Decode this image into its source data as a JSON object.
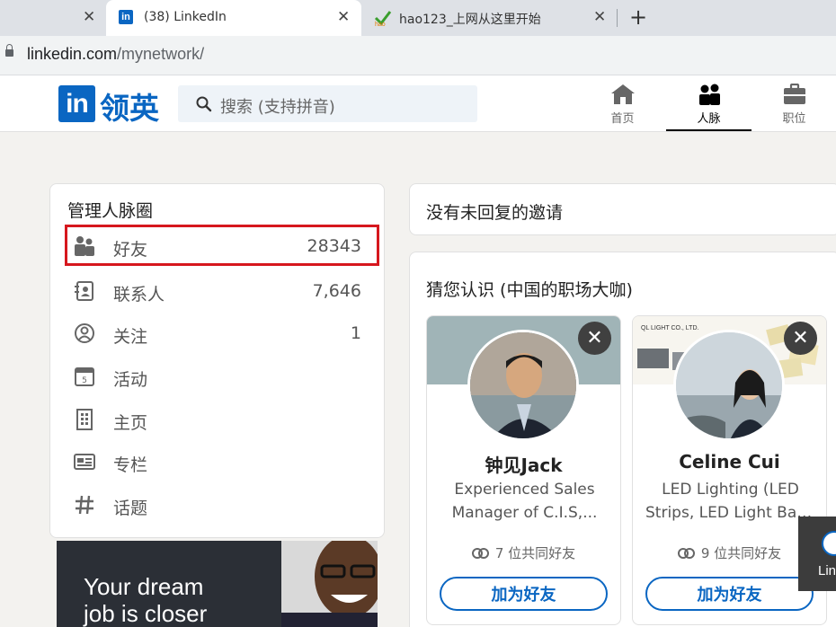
{
  "browser": {
    "tabs": [
      {
        "title": "",
        "close": "✕"
      },
      {
        "title": "(38) LinkedIn",
        "close": "✕"
      },
      {
        "title": "hao123_上网从这里开始",
        "close": "✕"
      }
    ],
    "new_tab": "+",
    "url_host": "linkedin.com",
    "url_path": "/mynetwork/"
  },
  "header": {
    "logo_mark": "in",
    "logo_text": "领英",
    "search_placeholder": "搜索 (支持拼音)",
    "nav": [
      {
        "label": "首页",
        "icon": "home-icon"
      },
      {
        "label": "人脉",
        "icon": "people-icon",
        "active": true
      },
      {
        "label": "职位",
        "icon": "briefcase-icon"
      }
    ]
  },
  "manage": {
    "title": "管理人脉圈",
    "items": [
      {
        "label": "好友",
        "count": "28343",
        "icon": "connections-icon",
        "highlighted": true
      },
      {
        "label": "联系人",
        "count": "7,646",
        "icon": "contacts-icon"
      },
      {
        "label": "关注",
        "count": "1",
        "icon": "following-icon"
      },
      {
        "label": "活动",
        "count": "",
        "icon": "calendar-icon"
      },
      {
        "label": "主页",
        "count": "",
        "icon": "building-icon"
      },
      {
        "label": "专栏",
        "count": "",
        "icon": "newspaper-icon"
      },
      {
        "label": "话题",
        "count": "",
        "icon": "hashtag-icon"
      }
    ],
    "ad_text_line1": "Your dream",
    "ad_text_line2": "job is closer"
  },
  "invitations": {
    "text": "没有未回复的邀请"
  },
  "pymk": {
    "title": "猜您认识 (中国的职场大咖)",
    "people": [
      {
        "name": "钟见Jack",
        "headline_line1": "Experienced Sales",
        "headline_line2": "Manager of C.I.S,...",
        "mutual": "7 位共同好友",
        "button": "加为好友",
        "dismiss": "✕"
      },
      {
        "name": "Celine Cui",
        "banner_text": "QL LIGHT CO., LTD.",
        "headline_line1": "LED Lighting (LED",
        "headline_line2": "Strips, LED Light Bar...",
        "mutual": "9 位共同好友",
        "button": "加为好友",
        "dismiss": "✕"
      }
    ]
  },
  "messaging": {
    "label": "Lin"
  },
  "colors": {
    "brand": "#0a66c2",
    "highlight": "#d6171e"
  }
}
